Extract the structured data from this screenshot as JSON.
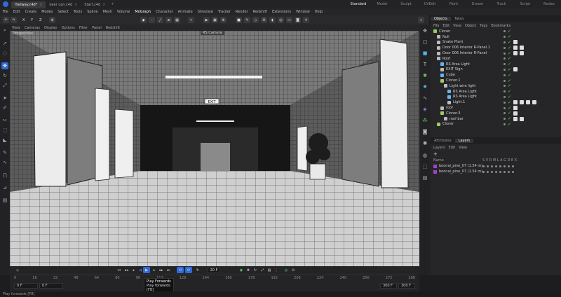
{
  "tabs": [
    {
      "label": "Hallway.c4d*",
      "active": true
    },
    {
      "label": "beer can.c4d",
      "active": false
    },
    {
      "label": "Start.c4d",
      "active": false
    }
  ],
  "layouts": [
    "Standard",
    "Model",
    "Sculpt",
    "UVEdit",
    "Paint",
    "Groom",
    "Track",
    "Script",
    "Nodes"
  ],
  "menu": [
    "File",
    "Edit",
    "Create",
    "Modes",
    "Select",
    "Tools",
    "Spline",
    "Mesh",
    "Volume",
    "MoGraph",
    "Character",
    "Animate",
    "Simulate",
    "Tracker",
    "Render",
    "Redshift",
    "Extensions",
    "Window",
    "Help"
  ],
  "toolbar": {
    "x": "X",
    "y": "Y",
    "z": "Z"
  },
  "viewport": {
    "menu": [
      "View",
      "Cameras",
      "Display",
      "Options",
      "Filter",
      "Panel",
      "Redshift"
    ],
    "projection": "Perspective",
    "camera": "RS Camera",
    "exit_sign": "EXIT"
  },
  "objects": {
    "tabs": [
      "Objects",
      "Takes"
    ],
    "menu": [
      "File",
      "Edit",
      "View",
      "Object",
      "Tags",
      "Bookmarks"
    ],
    "rows": [
      {
        "name": "Cloner",
        "indent": 0,
        "color": "#9ccc65",
        "tags": 0
      },
      {
        "name": "Null",
        "indent": 1,
        "color": "#bbbbbb",
        "tags": 0
      },
      {
        "name": "Snake Plant",
        "indent": 1,
        "color": "#bbbbbb",
        "tags": 1
      },
      {
        "name": "Door 006 Interior R-Panel.1",
        "indent": 1,
        "color": "#bbbbbb",
        "tags": 2
      },
      {
        "name": "Door 006 Interior R-Panel",
        "indent": 1,
        "color": "#bbbbbb",
        "tags": 2
      },
      {
        "name": "Roof",
        "indent": 1,
        "color": "#bbbbbb",
        "tags": 0
      },
      {
        "name": "RS Area Light",
        "indent": 2,
        "color": "#64b5f6",
        "tags": 0
      },
      {
        "name": "EXIT Sign",
        "indent": 2,
        "color": "#bbbbbb",
        "tags": 1
      },
      {
        "name": "Cube",
        "indent": 2,
        "color": "#64b5f6",
        "tags": 0
      },
      {
        "name": "Cloner.1",
        "indent": 2,
        "color": "#9ccc65",
        "tags": 0
      },
      {
        "name": "Light wire light",
        "indent": 3,
        "color": "#bbbbbb",
        "tags": 0
      },
      {
        "name": "RS Area Light",
        "indent": 4,
        "color": "#64b5f6",
        "tags": 0
      },
      {
        "name": "RS Area Light",
        "indent": 4,
        "color": "#64b5f6",
        "tags": 0
      },
      {
        "name": "Light.1",
        "indent": 4,
        "color": "#bbbbbb",
        "tags": 4
      },
      {
        "name": "roof",
        "indent": 2,
        "color": "#bbbbbb",
        "tags": 1
      },
      {
        "name": "Cloner.3",
        "indent": 2,
        "color": "#9ccc65",
        "tags": 1
      },
      {
        "name": "roof bar",
        "indent": 3,
        "color": "#bbbbbb",
        "tags": 2
      },
      {
        "name": "Cloner",
        "indent": 1,
        "color": "#9ccc65",
        "tags": 0
      }
    ]
  },
  "attributes": {
    "tabs": [
      "Attributes",
      "Layers"
    ],
    "menu": [
      "Layers",
      "Edit",
      "View"
    ],
    "name_header": "Name",
    "cols": "S V R M L A G D E X",
    "layers": [
      {
        "name": "boonai_pine_07 (1.54 m)"
      },
      {
        "name": "boonai_pine_07 (1.54 m)"
      }
    ]
  },
  "timeline": {
    "current_frame": "0 F",
    "start": "0 F",
    "start2": "0 F",
    "end": "300 F",
    "end2": "300 F",
    "frame_field": "20 F",
    "ticks": [
      "0",
      "16",
      "32",
      "48",
      "64",
      "80",
      "96",
      "112",
      "128",
      "144",
      "160",
      "176",
      "192",
      "208",
      "224",
      "240",
      "256",
      "272",
      "288"
    ]
  },
  "tooltip": {
    "title": "Play Forwards",
    "desc": "Play forwards",
    "key": "[F8]"
  },
  "status": "Play forwards [F8]",
  "colors": {
    "accent": "#2f6bd8",
    "selection": "#a23fd0"
  }
}
